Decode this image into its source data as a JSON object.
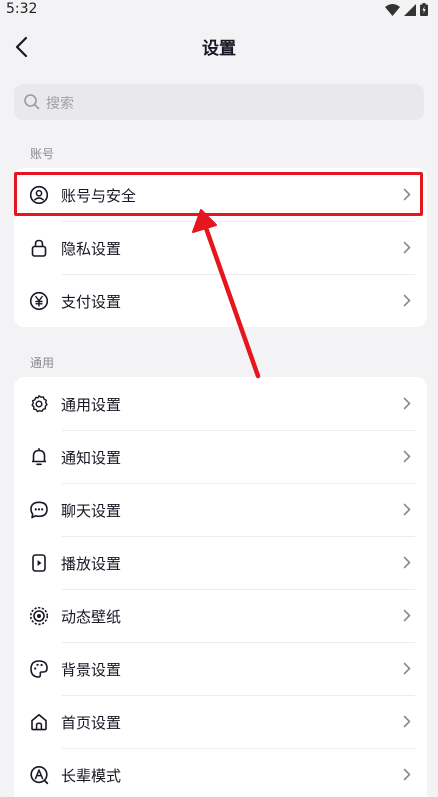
{
  "status_bar": {
    "time": "5:32"
  },
  "header": {
    "title": "设置"
  },
  "search": {
    "placeholder": "搜索"
  },
  "sections": {
    "account": {
      "label": "账号",
      "items": [
        {
          "label": "账号与安全",
          "icon": "user-circle-icon"
        },
        {
          "label": "隐私设置",
          "icon": "lock-icon"
        },
        {
          "label": "支付设置",
          "icon": "yen-circle-icon"
        }
      ]
    },
    "general": {
      "label": "通用",
      "items": [
        {
          "label": "通用设置",
          "icon": "gear-icon"
        },
        {
          "label": "通知设置",
          "icon": "bell-icon"
        },
        {
          "label": "聊天设置",
          "icon": "chat-bubble-icon"
        },
        {
          "label": "播放设置",
          "icon": "phone-play-icon"
        },
        {
          "label": "动态壁纸",
          "icon": "dynamic-wallpaper-icon"
        },
        {
          "label": "背景设置",
          "icon": "palette-icon"
        },
        {
          "label": "首页设置",
          "icon": "home-icon"
        },
        {
          "label": "长辈模式",
          "icon": "elder-mode-icon"
        }
      ]
    }
  },
  "colors": {
    "highlight": "#e5161d",
    "background": "#f3f3f5",
    "card": "#ffffff"
  }
}
